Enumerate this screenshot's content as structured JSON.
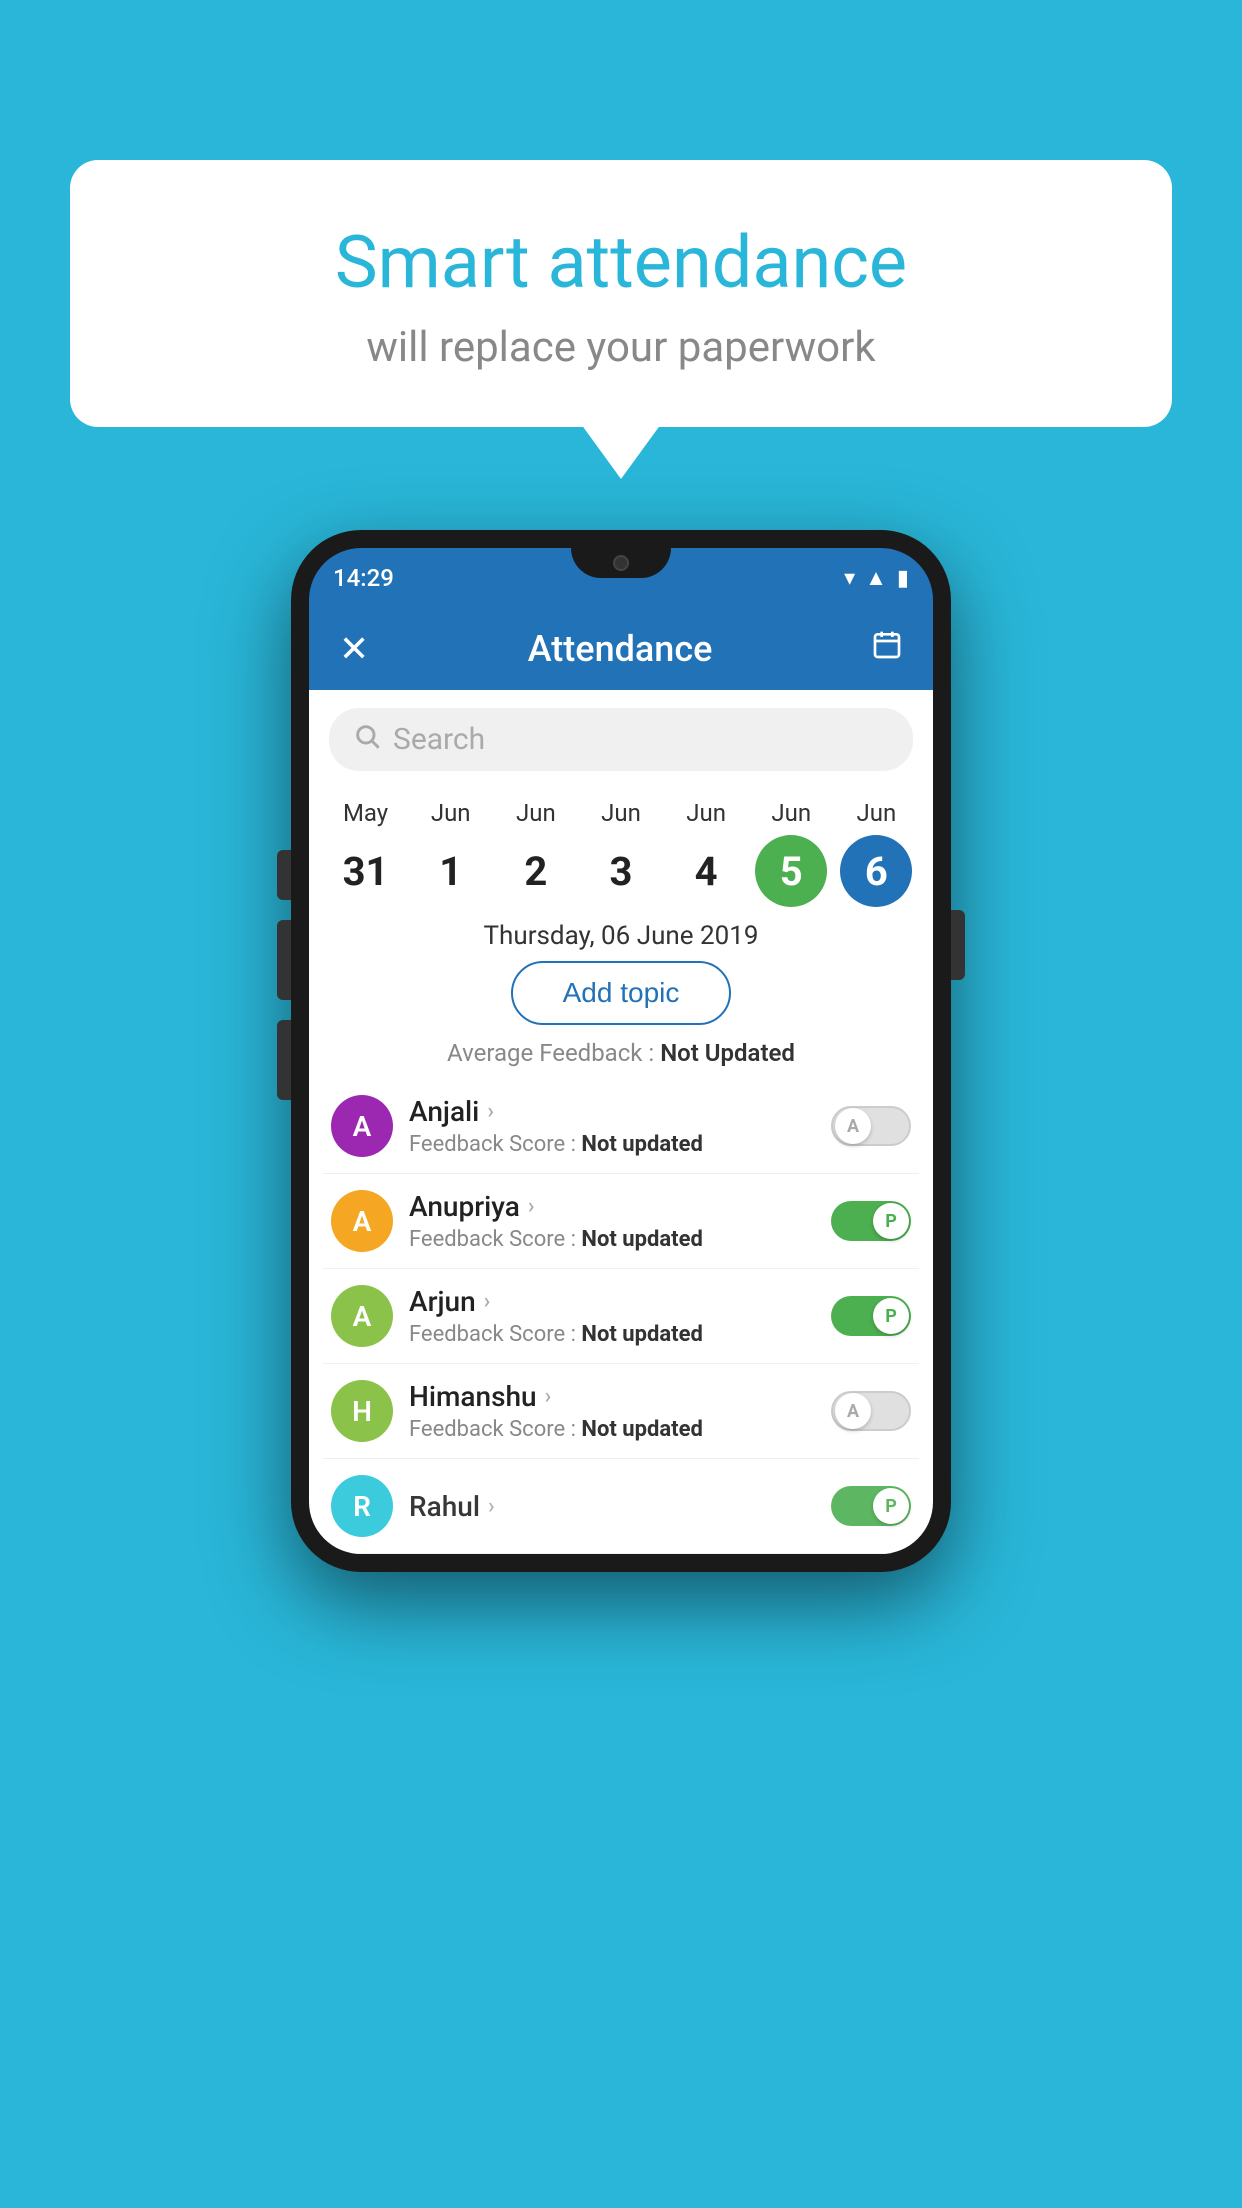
{
  "background_color": "#29b6d8",
  "speech_bubble": {
    "title": "Smart attendance",
    "subtitle": "will replace your paperwork"
  },
  "phone": {
    "status_bar": {
      "time": "14:29",
      "icons": [
        "wifi",
        "signal",
        "battery"
      ]
    },
    "header": {
      "close_icon": "✕",
      "title": "Attendance",
      "calendar_icon": "📅"
    },
    "search": {
      "placeholder": "Search"
    },
    "date_strip": [
      {
        "month": "May",
        "day": "31",
        "style": "normal"
      },
      {
        "month": "Jun",
        "day": "1",
        "style": "normal"
      },
      {
        "month": "Jun",
        "day": "2",
        "style": "normal"
      },
      {
        "month": "Jun",
        "day": "3",
        "style": "normal"
      },
      {
        "month": "Jun",
        "day": "4",
        "style": "normal"
      },
      {
        "month": "Jun",
        "day": "5",
        "style": "green"
      },
      {
        "month": "Jun",
        "day": "6",
        "style": "blue"
      }
    ],
    "selected_date": "Thursday, 06 June 2019",
    "add_topic_label": "Add topic",
    "average_feedback_label": "Average Feedback :",
    "average_feedback_value": "Not Updated",
    "students": [
      {
        "name": "Anjali",
        "avatar_letter": "A",
        "avatar_color": "#9c27b0",
        "feedback_label": "Feedback Score :",
        "feedback_value": "Not updated",
        "toggle": "off",
        "toggle_letter": "A"
      },
      {
        "name": "Anupriya",
        "avatar_letter": "A",
        "avatar_color": "#f5a623",
        "feedback_label": "Feedback Score :",
        "feedback_value": "Not updated",
        "toggle": "on",
        "toggle_letter": "P"
      },
      {
        "name": "Arjun",
        "avatar_letter": "A",
        "avatar_color": "#8bc34a",
        "feedback_label": "Feedback Score :",
        "feedback_value": "Not updated",
        "toggle": "on",
        "toggle_letter": "P"
      },
      {
        "name": "Himanshu",
        "avatar_letter": "H",
        "avatar_color": "#8bc34a",
        "feedback_label": "Feedback Score :",
        "feedback_value": "Not updated",
        "toggle": "off",
        "toggle_letter": "A"
      }
    ],
    "partial_student": {
      "avatar_letter": "R",
      "avatar_color": "#26c6da",
      "name": "Rahul"
    }
  }
}
